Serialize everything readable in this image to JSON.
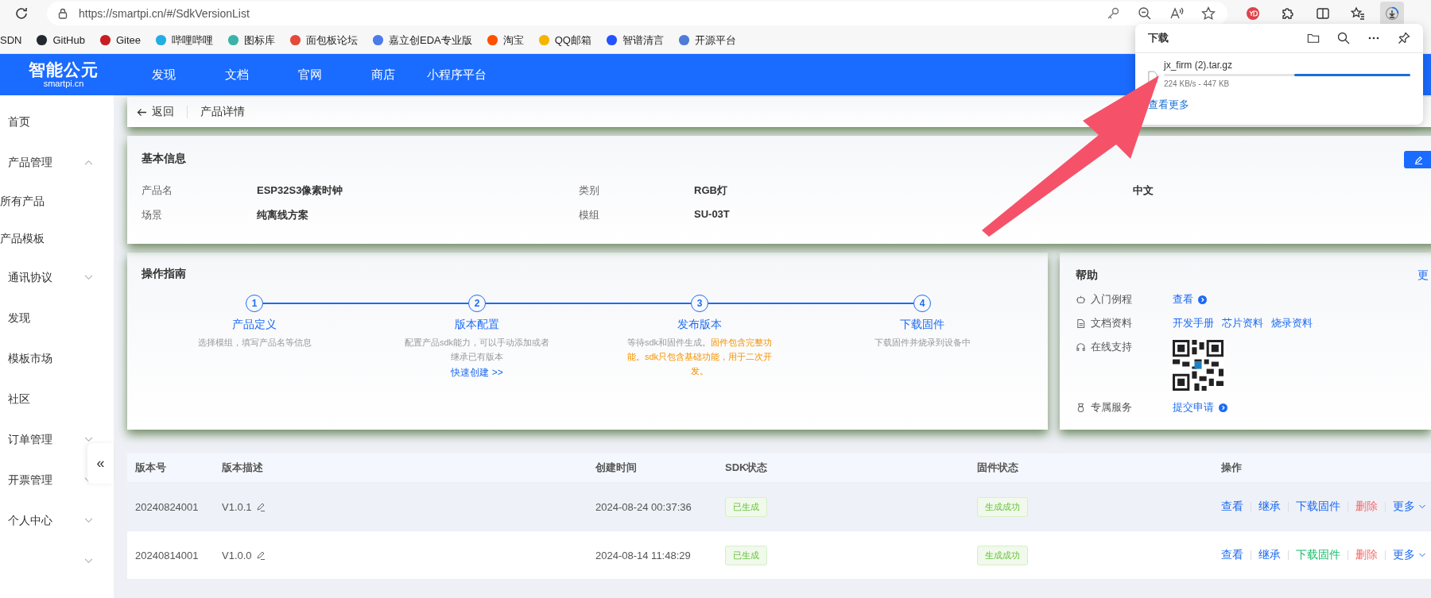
{
  "browser": {
    "url": "https://smartpi.cn/#/SdkVersionList",
    "bookmarks": [
      {
        "label": "SDN"
      },
      {
        "label": "GitHub",
        "color": "#24292f"
      },
      {
        "label": "Gitee",
        "color": "#c71d23"
      },
      {
        "label": "哔哩哔哩",
        "color": "#23ade5"
      },
      {
        "label": "图标库",
        "color": "#3bb2a8"
      },
      {
        "label": "面包板论坛",
        "color": "#e5493a"
      },
      {
        "label": "嘉立创EDA专业版",
        "color": "#4b7bec"
      },
      {
        "label": "淘宝",
        "color": "#ff5000"
      },
      {
        "label": "QQ邮箱",
        "color": "#f5b400"
      },
      {
        "label": "智谱清言",
        "color": "#2454ff"
      },
      {
        "label": "开源平台",
        "color": "#4f7bd9"
      }
    ]
  },
  "header": {
    "logo": "智能公元",
    "logo_sub": "smartpi.cn",
    "nav": [
      "发现",
      "文档",
      "官网",
      "商店",
      "小程序平台"
    ]
  },
  "sidebar": {
    "items": [
      {
        "label": "首页"
      },
      {
        "label": "产品管理",
        "expanded": true,
        "children": [
          {
            "label": "所有产品"
          },
          {
            "label": "产品模板"
          }
        ]
      },
      {
        "label": "通讯协议",
        "expanded": false
      },
      {
        "label": "发现"
      },
      {
        "label": "模板市场"
      },
      {
        "label": "社区"
      },
      {
        "label": "订单管理",
        "expanded": false
      },
      {
        "label": "开票管理",
        "expanded": false
      },
      {
        "label": "个人中心",
        "expanded": false
      },
      {
        "expanded": false
      }
    ],
    "collapse_button": "«"
  },
  "breadcrumb": {
    "back": "返回",
    "current": "产品详情"
  },
  "basic_info": {
    "title": "基本信息",
    "fields": [
      {
        "label": "产品名",
        "value": "ESP32S3像素时钟"
      },
      {
        "label": "类别",
        "value": "RGB灯"
      },
      {
        "value": "中文"
      },
      {
        "label": "场景",
        "value": "纯离线方案"
      },
      {
        "label": "模组",
        "value": "SU-03T"
      }
    ]
  },
  "guide": {
    "title": "操作指南",
    "steps": [
      {
        "number": "1",
        "title": "产品定义",
        "desc": "选择模组，填写产品名等信息"
      },
      {
        "number": "2",
        "title": "版本配置",
        "desc": "配置产品sdk能力，可以手动添加或者继承已有版本",
        "link": "快速创建 >>"
      },
      {
        "number": "3",
        "title": "发布版本",
        "desc": "等待sdk和固件生成。",
        "note": "固件包含完整功能。sdk只包含基础功能，用于二次开发。"
      },
      {
        "number": "4",
        "title": "下载固件",
        "desc": "下载固件并烧录到设备中"
      }
    ]
  },
  "help": {
    "title": "帮助",
    "more": "更",
    "rows": [
      {
        "kind": "links",
        "label": "入门例程",
        "links": [
          "查看"
        ],
        "arrow": true
      },
      {
        "kind": "links",
        "label": "文档资料",
        "links": [
          "开发手册",
          "芯片资料",
          "烧录资料"
        ]
      },
      {
        "kind": "qr",
        "label": "在线支持"
      },
      {
        "kind": "links",
        "label": "专属服务",
        "links": [
          "提交申请"
        ],
        "arrow": true
      }
    ]
  },
  "table": {
    "columns": [
      "版本号",
      "版本描述",
      "创建时间",
      "SDK状态",
      "固件状态",
      "操作"
    ],
    "rows": [
      {
        "highlighted": true,
        "version": "20240824001",
        "desc": "V1.0.1",
        "created": "2024-08-24 00:37:36",
        "sdk_status": "已生成",
        "fw_status": "生成成功",
        "actions": [
          {
            "label": "查看",
            "color": "#1d6bf3"
          },
          {
            "label": "继承",
            "color": "#1d6bf3"
          },
          {
            "label": "下载固件",
            "color": "#1d6bf3"
          },
          {
            "label": "删除",
            "color": "#f56c6c"
          },
          {
            "label": "更多",
            "color": "#1d6bf3"
          }
        ]
      },
      {
        "highlighted": false,
        "version": "20240814001",
        "desc": "V1.0.0",
        "created": "2024-08-14 11:48:29",
        "sdk_status": "已生成",
        "fw_status": "生成成功",
        "actions": [
          {
            "label": "查看",
            "color": "#1d6bf3"
          },
          {
            "label": "继承",
            "color": "#1d6bf3"
          },
          {
            "label": "下载固件",
            "color": "#19be6b"
          },
          {
            "label": "删除",
            "color": "#f56c6c"
          },
          {
            "label": "更多",
            "color": "#1d6bf3"
          }
        ]
      }
    ]
  },
  "downloads": {
    "title": "下载",
    "more": "查看更多",
    "items": [
      {
        "name": "jx_firm (2).tar.gz",
        "status": "224 KB/s - 447 KB",
        "level": 0.47
      }
    ]
  }
}
